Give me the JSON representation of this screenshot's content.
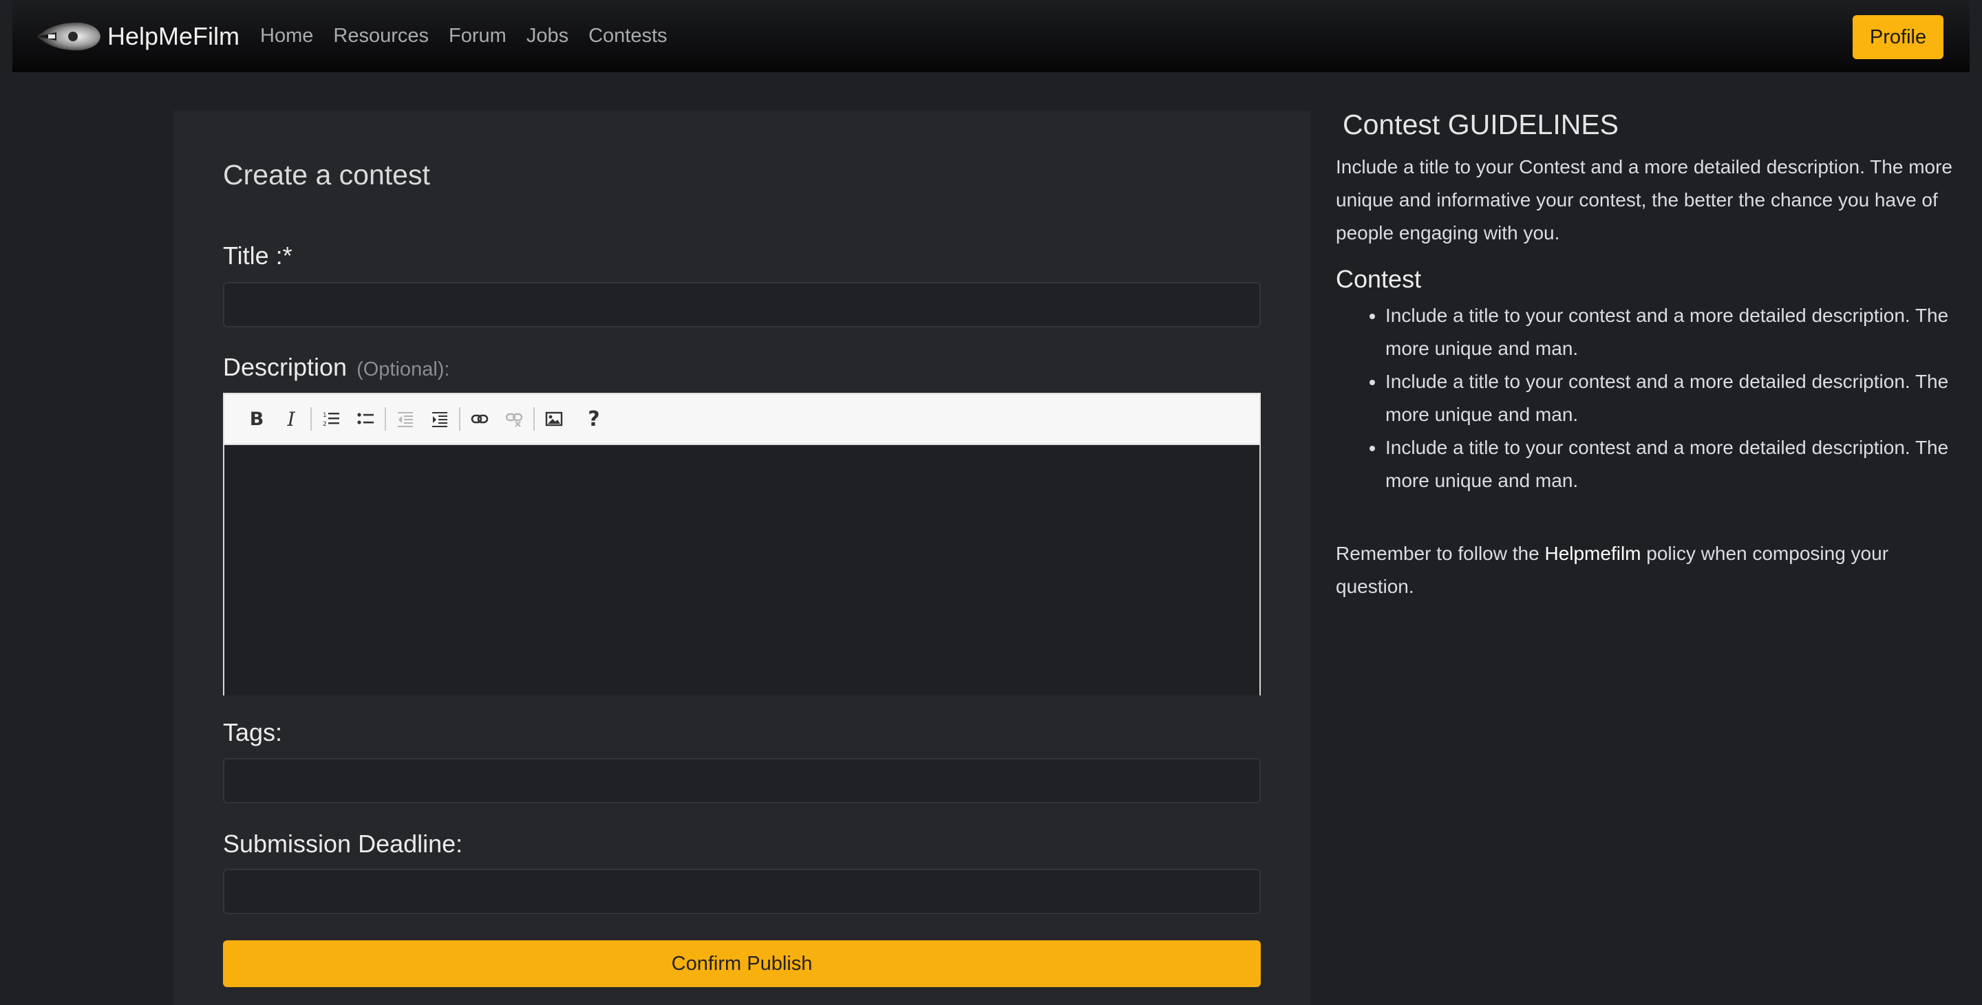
{
  "navbar": {
    "brand": "HelpMeFilm",
    "links": [
      "Home",
      "Resources",
      "Forum",
      "Jobs",
      "Contests"
    ],
    "profile_label": "Profile"
  },
  "form": {
    "heading": "Create a contest",
    "title_label": "Title :*",
    "title_value": "",
    "description_label": "Description",
    "description_optional": "(Optional):",
    "tags_label": "Tags:",
    "tags_value": "",
    "deadline_label": "Submission Deadline:",
    "deadline_value": "",
    "submit_label": "Confirm Publish",
    "toolbar": {
      "bold": "B",
      "italic": "I",
      "help": "?"
    }
  },
  "guidelines": {
    "title": "Contest GUIDELINES",
    "intro": "Include a title to your Contest and a more detailed description. The more unique and informative your contest, the better the chance you have of people engaging with you.",
    "subheading": "Contest",
    "items": [
      "Include a title to your contest and a more detailed description. The more unique and man.",
      "Include a title to your contest and a more detailed description. The more unique and man.",
      "Include a title to your contest and a more detailed description. The more unique and man."
    ],
    "policy_before": "Remember to follow the ",
    "policy_link": "Helpmefilm",
    "policy_after": " policy when composing your question."
  },
  "colors": {
    "accent": "#f8b00e",
    "page_bg": "#1f2024",
    "card_bg": "#26272b"
  }
}
